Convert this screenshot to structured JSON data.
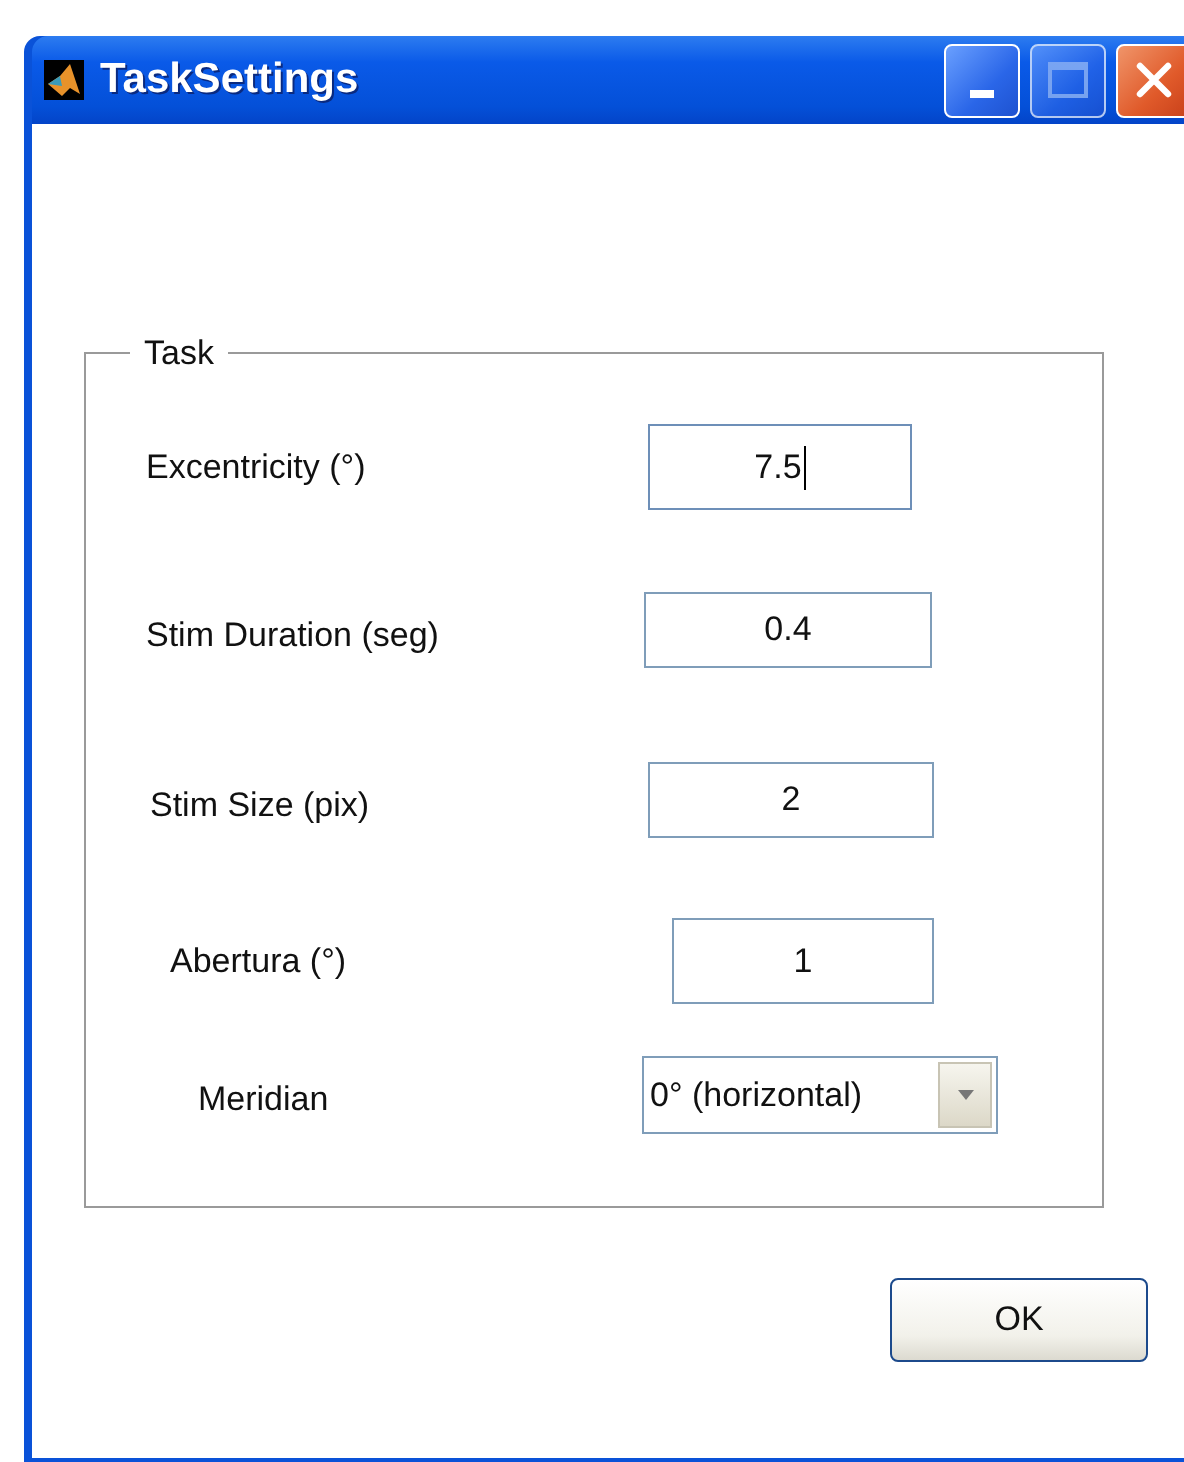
{
  "window": {
    "title": "TaskSettings"
  },
  "panel": {
    "title": "Task",
    "fields": [
      {
        "kind": "text",
        "label": "Excentricity (°)",
        "value": "7.5",
        "focused": true
      },
      {
        "kind": "text",
        "label": "Stim Duration (seg)",
        "value": "0.4",
        "focused": false
      },
      {
        "kind": "text",
        "label": "Stim Size (pix)",
        "value": "2",
        "focused": false
      },
      {
        "kind": "text",
        "label": "Abertura (°)",
        "value": "1",
        "focused": false
      },
      {
        "kind": "dropdown",
        "label": "Meridian",
        "value": "0° (horizontal)"
      }
    ]
  },
  "buttons": [
    "OK"
  ]
}
